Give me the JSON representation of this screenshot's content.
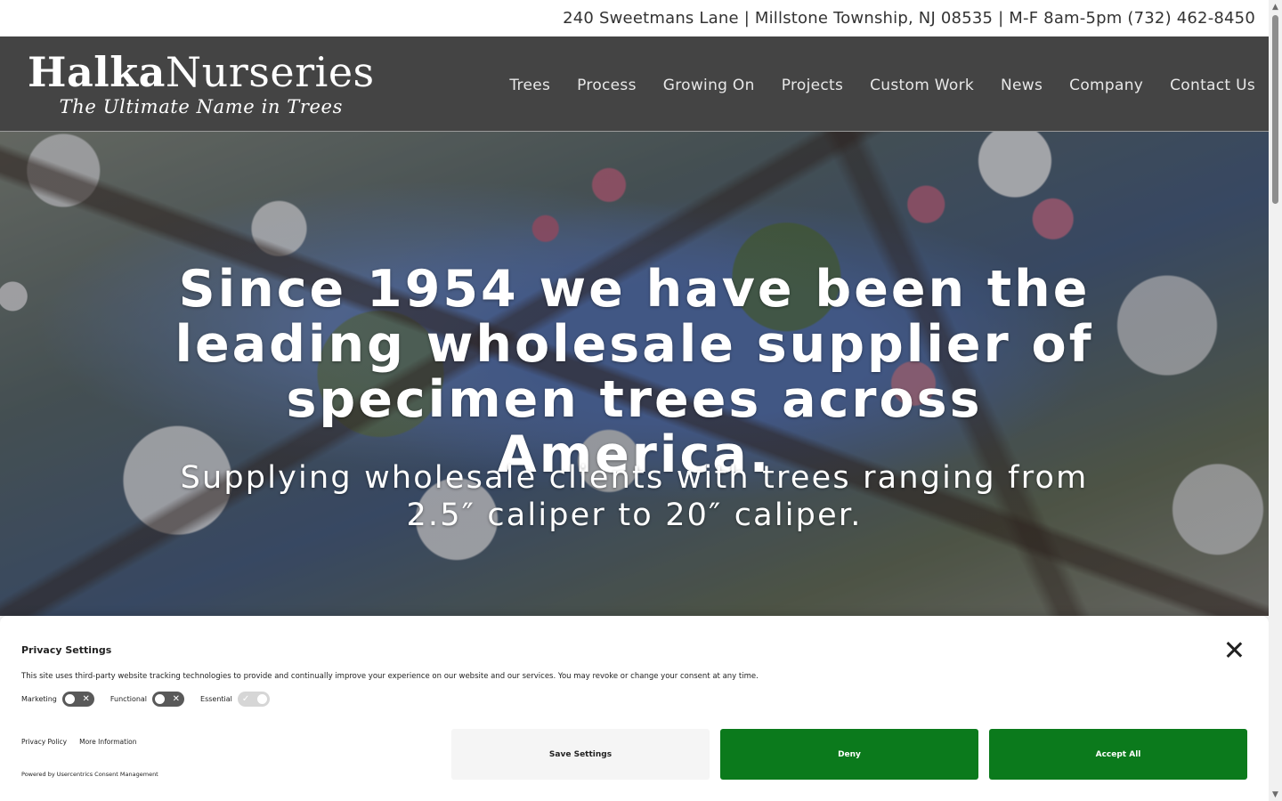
{
  "topbar": {
    "contact_line": "240 Sweetmans Lane | Millstone Township, NJ 08535 | M-F 8am-5pm (732) 462-8450"
  },
  "header": {
    "logo_bold": "Halka",
    "logo_light": "Nurseries",
    "tagline": "The Ultimate Name in Trees"
  },
  "nav": {
    "items": [
      {
        "label": "Trees"
      },
      {
        "label": "Process"
      },
      {
        "label": "Growing On"
      },
      {
        "label": "Projects"
      },
      {
        "label": "Custom Work"
      },
      {
        "label": "News"
      },
      {
        "label": "Company"
      },
      {
        "label": "Contact Us"
      }
    ]
  },
  "hero": {
    "heading": "Since 1954 we have been the leading wholesale supplier of specimen trees across America.",
    "subheading": "Supplying wholesale clients with trees ranging from 2.5″ caliper to 20″ caliper."
  },
  "consent": {
    "title": "Privacy Settings",
    "description": "This site uses third-party website tracking technologies to provide and continually improve your experience on our website and our services. You may revoke or change your consent at any time.",
    "toggles": [
      {
        "label": "Marketing",
        "state": "off"
      },
      {
        "label": "Functional",
        "state": "off"
      },
      {
        "label": "Essential",
        "state": "on-disabled"
      }
    ],
    "links": {
      "privacy_policy": "Privacy Policy",
      "more_info": "More Information"
    },
    "powered_by": "Powered by Usercentrics Consent Management",
    "buttons": {
      "save": "Save Settings",
      "deny": "Deny",
      "accept": "Accept All"
    }
  },
  "colors": {
    "header_bg": "#444444",
    "button_green": "#0b7a1c",
    "save_bg": "#f5f5f5"
  },
  "icons": {
    "close": "close-icon",
    "toggle_off": "x-mark-icon",
    "toggle_on": "check-mark-icon"
  }
}
